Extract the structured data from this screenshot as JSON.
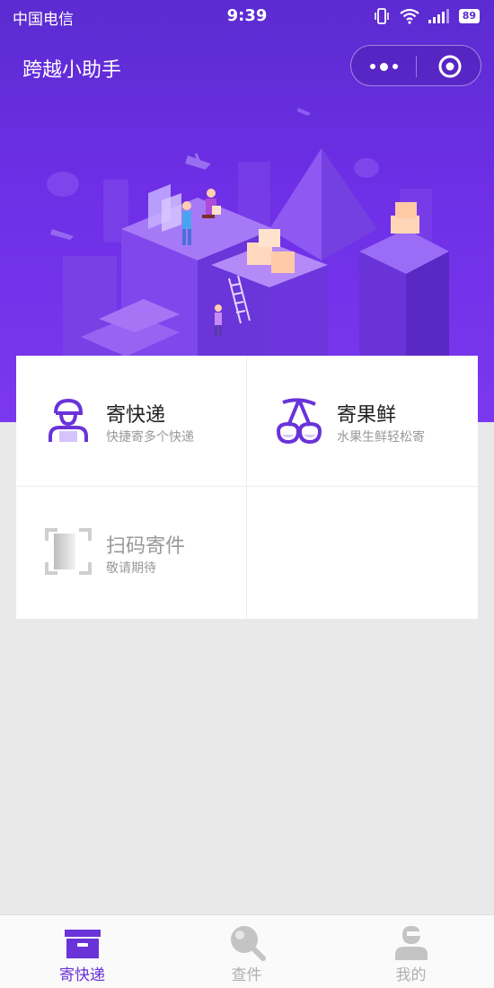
{
  "status_bar": {
    "carrier": "中国电信",
    "time": "9:39",
    "battery": "89"
  },
  "header": {
    "title": "跨越小助手"
  },
  "services": [
    {
      "title": "寄快递",
      "subtitle": "快捷寄多个快递",
      "icon": "courier-person-icon",
      "enabled": true
    },
    {
      "title": "寄果鲜",
      "subtitle": "水果生鲜轻松寄",
      "icon": "cherry-icon",
      "enabled": true
    },
    {
      "title": "扫码寄件",
      "subtitle": "敬请期待",
      "icon": "scan-frame-icon",
      "enabled": false
    }
  ],
  "tabbar": {
    "tabs": [
      {
        "label": "寄快递",
        "icon": "box-icon",
        "active": true
      },
      {
        "label": "查件",
        "icon": "magnifier-icon",
        "active": false
      },
      {
        "label": "我的",
        "icon": "user-icon",
        "active": false
      }
    ]
  },
  "colors": {
    "brand": "#6a33d8",
    "inactive": "#b0b0b0"
  }
}
